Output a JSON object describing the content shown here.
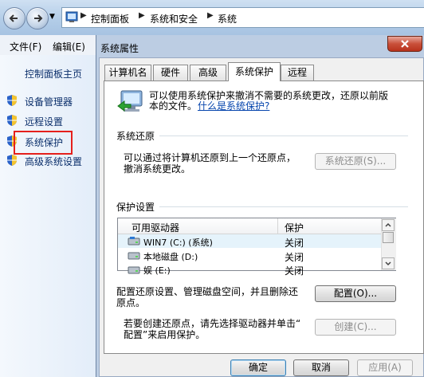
{
  "explorer": {
    "breadcrumbs": [
      "控制面板",
      "系统和安全",
      "系统"
    ],
    "menu": [
      "文件(F)",
      "编辑(E)"
    ]
  },
  "left_pane": {
    "home": "控制面板主页",
    "links": [
      {
        "label": "设备管理器",
        "icon": "uac-shield-icon"
      },
      {
        "label": "远程设置",
        "icon": "uac-shield-icon"
      },
      {
        "label": "系统保护",
        "icon": "uac-shield-icon",
        "highlighted": true
      },
      {
        "label": "高级系统设置",
        "icon": "uac-shield-icon"
      }
    ]
  },
  "dialog": {
    "title": "系统属性",
    "tabs": [
      "计算机名",
      "硬件",
      "高级",
      "系统保护",
      "远程"
    ],
    "active_tab": "系统保护",
    "intro_line1": "可以使用系统保护来撤消不需要的系统更改，还原以前版",
    "intro_line2": "本的文件。",
    "intro_link": "什么是系统保护?",
    "restore_group": "系统还原",
    "restore_text_line1": "可以通过将计算机还原到上一个还原点，",
    "restore_text_line2": "撤消系统更改。",
    "restore_button": "系统还原(S)...",
    "protection_group": "保护设置",
    "list_headers": [
      "可用驱动器",
      "保护"
    ],
    "drives": [
      {
        "name": "WIN7 (C:) (系统)",
        "protection": "关闭",
        "selected": true
      },
      {
        "name": "本地磁盘 (D:)",
        "protection": "关闭"
      },
      {
        "name": "娱 (E:)",
        "protection": "关闭"
      }
    ],
    "config_text_line1": "配置还原设置、管理磁盘空间，并且删除还",
    "config_text_line2": "原点。",
    "config_button": "配置(O)...",
    "create_text_line1": "若要创建还原点，请先选择驱动器并单击“",
    "create_text_line2": "配置”来启用保护。",
    "create_button": "创建(C)...",
    "ok_button": "确定",
    "cancel_button": "取消",
    "apply_button": "应用(A)"
  },
  "colors": {
    "highlight_box": "#e5201c",
    "link": "#0645ad"
  }
}
